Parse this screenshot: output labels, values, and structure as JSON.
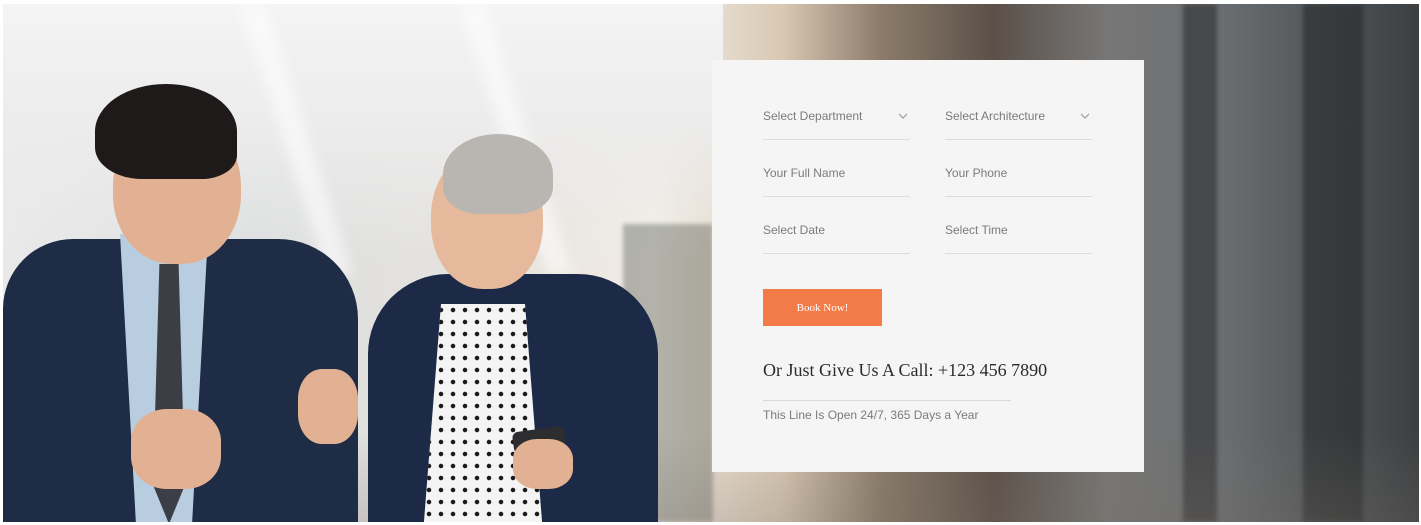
{
  "booking_form": {
    "department_select": {
      "value": "Select Department"
    },
    "architecture_select": {
      "value": "Select Architecture"
    },
    "full_name_input": {
      "placeholder": "Your Full Name"
    },
    "phone_input": {
      "placeholder": "Your Phone"
    },
    "date_input": {
      "placeholder": "Select Date"
    },
    "time_input": {
      "placeholder": "Select Time"
    },
    "submit_label": "Book Now!",
    "call_text": "Or Just Give Us A Call: +123 456 7890",
    "availability_text": "This Line Is Open 24/7, 365 Days a Year"
  },
  "colors": {
    "accent": "#f37b48",
    "card_background": "#f5f5f5",
    "text_muted": "#7b7b7b",
    "text_dark": "#2b2b2b"
  },
  "icons": {
    "dropdown": "chevron-down-icon"
  },
  "hero_image": {
    "subject": "two business people talking in an office lobby"
  }
}
